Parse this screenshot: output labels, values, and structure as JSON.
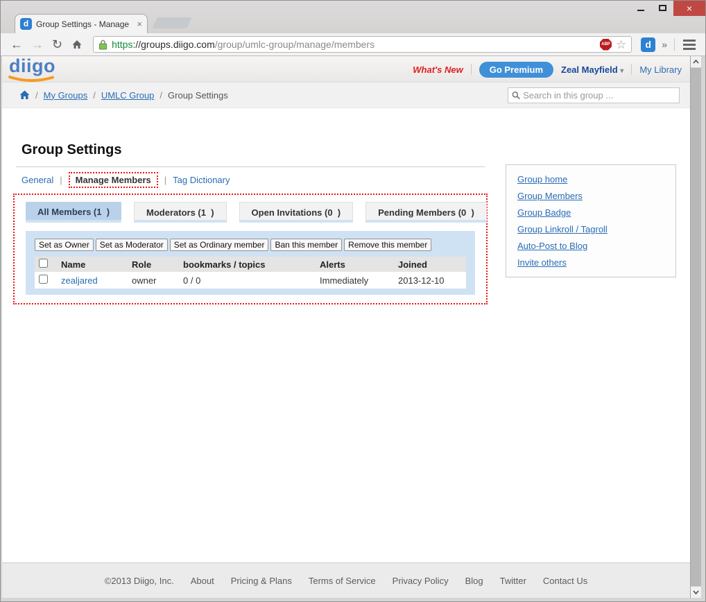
{
  "browser": {
    "tab_title": "Group Settings - Manage",
    "favicon_letter": "d",
    "extension_letter": "d",
    "abp_label": "ABP",
    "url": {
      "scheme": "https",
      "host": "://groups.diigo.com",
      "path": "/group/umlc-group/manage/members"
    }
  },
  "icons": {
    "back": "←",
    "forward": "→",
    "reload": "↻",
    "star": "☆",
    "overflow": "»",
    "tab_close": "×",
    "window_close": "×",
    "dropdown": "▾",
    "crumb_sep": "/",
    "tab_sep": "|"
  },
  "header": {
    "logo": "diigo",
    "whats_new": "What's New",
    "go_premium": "Go Premium",
    "user_name": "Zeal Mayfield",
    "my_library": "My Library"
  },
  "breadcrumb": {
    "items": [
      "My Groups",
      "UMLC Group"
    ],
    "current": "Group Settings"
  },
  "search": {
    "placeholder": "Search in this group ..."
  },
  "page": {
    "title": "Group Settings",
    "tabs": {
      "general": "General",
      "manage_members": "Manage Members",
      "tag_dictionary": "Tag Dictionary"
    },
    "member_tabs": [
      {
        "label": "All Members (1  )"
      },
      {
        "label": "Moderators (1  )"
      },
      {
        "label": "Open Invitations (0  )"
      },
      {
        "label": "Pending Members (0  )"
      }
    ]
  },
  "actions": [
    "Set as Owner",
    "Set as Moderator",
    "Set as Ordinary member",
    "Ban this member",
    "Remove this member"
  ],
  "table": {
    "headers": [
      "Name",
      "Role",
      "bookmarks / topics",
      "Alerts",
      "Joined"
    ],
    "rows": [
      {
        "name": "zealjared",
        "role": "owner",
        "bookmarks_topics": "0 / 0",
        "alerts": "Immediately",
        "joined": "2013-12-10"
      }
    ]
  },
  "sidebar": {
    "links": [
      "Group home",
      "Group Members",
      "Group Badge",
      "Group Linkroll / Tagroll",
      "Auto-Post to Blog",
      "Invite others"
    ]
  },
  "footer": {
    "copyright": "©2013 Diigo, Inc.",
    "links": [
      "About",
      "Pricing & Plans",
      "Terms of Service",
      "Privacy Policy",
      "Blog",
      "Twitter",
      "Contact Us"
    ]
  },
  "colors": {
    "link_blue": "#2a6cb6",
    "brand_blue": "#4c7fc4",
    "brand_orange": "#f59b23",
    "premium_blue": "#3f90d8",
    "whats_new_red": "#e01f1f",
    "annotation_red": "#ee1111",
    "active_member_tab": "#b9d2ea",
    "panel_blue": "#cfe2f3",
    "close_button_red": "#c04843",
    "url_scheme_green": "#118a3c"
  }
}
